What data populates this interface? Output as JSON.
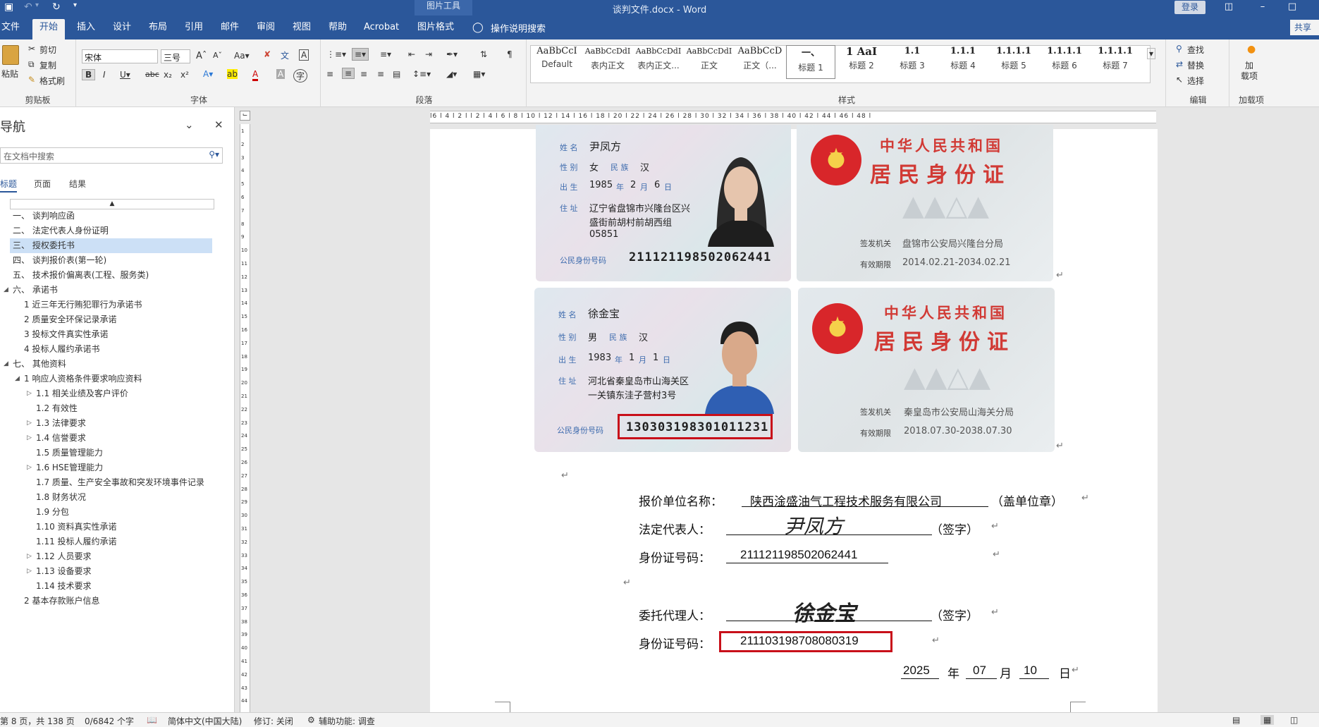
{
  "titlebar": {
    "context_tab_group": "图片工具",
    "doc_title": "谈判文件.docx  -  Word",
    "login": "登录"
  },
  "tabs": [
    {
      "label": "文件"
    },
    {
      "label": "开始"
    },
    {
      "label": "插入"
    },
    {
      "label": "设计"
    },
    {
      "label": "布局"
    },
    {
      "label": "引用"
    },
    {
      "label": "邮件"
    },
    {
      "label": "审阅"
    },
    {
      "label": "视图"
    },
    {
      "label": "帮助"
    },
    {
      "label": "Acrobat"
    },
    {
      "label": "图片格式"
    }
  ],
  "tell_me": "操作说明搜索",
  "share": "共享",
  "ribbon": {
    "clipboard": {
      "paste": "粘贴",
      "cut": "剪切",
      "copy": "复制",
      "format_painter": "格式刷",
      "label": "剪贴板"
    },
    "font": {
      "family": "宋体",
      "size": "三号",
      "label": "字体"
    },
    "paragraph": {
      "label": "段落"
    },
    "styles": {
      "label": "样式",
      "items": [
        {
          "preview": "AaBbCcI",
          "name": "Default"
        },
        {
          "preview": "AaBbCcDdI",
          "name": "表内正文"
        },
        {
          "preview": "AaBbCcDdI",
          "name": "表内正文..."
        },
        {
          "preview": "AaBbCcDdI",
          "name": "正文"
        },
        {
          "preview": "AaBbCcD",
          "name": "正文（..."
        },
        {
          "preview": "一、",
          "name": "标题 1"
        },
        {
          "preview": "1  AaI",
          "name": "标题 2"
        },
        {
          "preview": "1.1",
          "name": "标题 3"
        },
        {
          "preview": "1.1.1",
          "name": "标题 4"
        },
        {
          "preview": "1.1.1.1",
          "name": "标题 5"
        },
        {
          "preview": "1.1.1.1",
          "name": "标题 6"
        },
        {
          "preview": "1.1.1.1",
          "name": "标题 7"
        }
      ]
    },
    "editing": {
      "find": "查找",
      "replace": "替换",
      "select": "选择",
      "label": "编辑"
    },
    "addins": {
      "button": "加\n载项",
      "label": "加载项"
    }
  },
  "nav": {
    "title": "导航",
    "search_placeholder": "在文档中搜索",
    "tabs": [
      "标题",
      "页面",
      "结果"
    ],
    "items": [
      {
        "text": "一、 谈判响应函",
        "level": 1
      },
      {
        "text": "二、 法定代表人身份证明",
        "level": 1
      },
      {
        "text": "三、 授权委托书",
        "level": 1,
        "selected": true
      },
      {
        "text": "四、 谈判报价表(第一轮)",
        "level": 1
      },
      {
        "text": "五、 技术报价偏离表(工程、服务类)",
        "level": 1
      },
      {
        "text": "六、 承诺书",
        "level": 1,
        "expander": "collapse"
      },
      {
        "text": "1 近三年无行贿犯罪行为承诺书",
        "level": 2
      },
      {
        "text": "2 质量安全环保记录承诺",
        "level": 2
      },
      {
        "text": "3 投标文件真实性承诺",
        "level": 2
      },
      {
        "text": "4 投标人履约承诺书",
        "level": 2
      },
      {
        "text": "七、 其他资料",
        "level": 1,
        "expander": "collapse"
      },
      {
        "text": "1 响应人资格条件要求响应资料",
        "level": 2,
        "expander": "collapse"
      },
      {
        "text": "1.1 相关业绩及客户评价",
        "level": 3,
        "expander": "expand"
      },
      {
        "text": "1.2 有效性",
        "level": 3
      },
      {
        "text": "1.3 法律要求",
        "level": 3,
        "expander": "expand"
      },
      {
        "text": "1.4 信誉要求",
        "level": 3,
        "expander": "expand"
      },
      {
        "text": "1.5 质量管理能力",
        "level": 3
      },
      {
        "text": "1.6 HSE管理能力",
        "level": 3,
        "expander": "expand"
      },
      {
        "text": "1.7 质量、生产安全事故和突发环境事件记录",
        "level": 3
      },
      {
        "text": "1.8 财务状况",
        "level": 3
      },
      {
        "text": "1.9 分包",
        "level": 3
      },
      {
        "text": "1.10 资料真实性承诺",
        "level": 3
      },
      {
        "text": "1.11 投标人履约承诺",
        "level": 3
      },
      {
        "text": "1.12 人员要求",
        "level": 3,
        "expander": "expand"
      },
      {
        "text": "1.13 设备要求",
        "level": 3,
        "expander": "expand"
      },
      {
        "text": "1.14 技术要求",
        "level": 3
      },
      {
        "text": "2 基本存款账户信息",
        "level": 2
      }
    ]
  },
  "ruler": {
    "h_ticks": "l6 l 4 l 2 l   l 2 l 4 l 6 l 8 l 10 l 12 l 14 l 16 l 18 l 20 l 22 l 24 l 26 l 28 l 30 l 32 l 34 l 36 l 38 l 40 l 42 l 44 l 46 l 48 l",
    "v_ticks": [
      "1",
      "2",
      "3",
      "4",
      "5",
      "6",
      "7",
      "8",
      "9",
      "10",
      "11",
      "12",
      "13",
      "14",
      "15",
      "16",
      "17",
      "18",
      "19",
      "20",
      "21",
      "22",
      "23",
      "24",
      "25",
      "26",
      "27",
      "28",
      "29",
      "30",
      "31",
      "32",
      "33",
      "34",
      "35",
      "36",
      "37",
      "38",
      "39",
      "40",
      "41",
      "42",
      "43",
      "44"
    ]
  },
  "id_card_1": {
    "name_label": "姓  名",
    "name": "尹凤方",
    "sex_label": "性  别",
    "sex": "女",
    "ethnic_label": "民  族",
    "ethnic": "汉",
    "birth_label": "出  生",
    "birth_year": "1985",
    "year_unit": "年",
    "birth_month": "2",
    "month_unit": "月",
    "birth_day": "6",
    "day_unit": "日",
    "address_label": "住  址",
    "address_lines": [
      "辽宁省盘锦市兴隆台区兴",
      "盛街前胡村前胡西组",
      "05851"
    ],
    "id_label": "公民身份号码",
    "id_number": "211121198502062441",
    "back_title_1": "中华人民共和国",
    "back_title_2": "居民身份证",
    "issuer_label": "签发机关",
    "issuer": "盘锦市公安局兴隆台分局",
    "valid_label": "有效期限",
    "valid": "2014.02.21-2034.02.21"
  },
  "id_card_2": {
    "name_label": "姓  名",
    "name": "徐金宝",
    "sex_label": "性  别",
    "sex": "男",
    "ethnic_label": "民  族",
    "ethnic": "汉",
    "birth_label": "出  生",
    "birth_year": "1983",
    "year_unit": "年",
    "birth_month": "1",
    "month_unit": "月",
    "birth_day": "1",
    "day_unit": "日",
    "address_label": "住  址",
    "address_lines": [
      "河北省秦皇岛市山海关区",
      "一关镇东洼子营村3号"
    ],
    "id_label": "公民身份号码",
    "id_number": "130303198301011231",
    "back_title_1": "中华人民共和国",
    "back_title_2": "居民身份证",
    "issuer_label": "签发机关",
    "issuer": "秦皇岛市公安局山海关分局",
    "valid_label": "有效期限",
    "valid": "2018.07.30-2038.07.30"
  },
  "form": {
    "company_label": "报价单位名称：",
    "company": "陕西淦盛油气工程技术服务有限公司",
    "company_suffix": "（盖单位章）",
    "legal_rep_label": "法定代表人：",
    "legal_rep_sig": "尹凤方",
    "sign_suffix": "（签字）",
    "id_label": "身份证号码：",
    "legal_rep_id": "211121198502062441",
    "agent_label": "委托代理人：",
    "agent_sig": "徐金宝",
    "agent_id": "211103198708080319",
    "date_year": "2025",
    "date_year_unit": "年",
    "date_month": "07",
    "date_month_unit": "月",
    "date_day": "10",
    "date_day_unit": "日",
    "para_mark": "↵"
  },
  "status": {
    "page": "第 8 页，共 138 页",
    "words": "0/6842 个字",
    "language": "简体中文(中国大陆)",
    "track": "修订: 关闭",
    "accessibility": "辅助功能: 调查"
  },
  "colors": {
    "word_blue": "#2b579a",
    "highlight_red": "#c8101a",
    "nav_select": "#cce0f6"
  }
}
